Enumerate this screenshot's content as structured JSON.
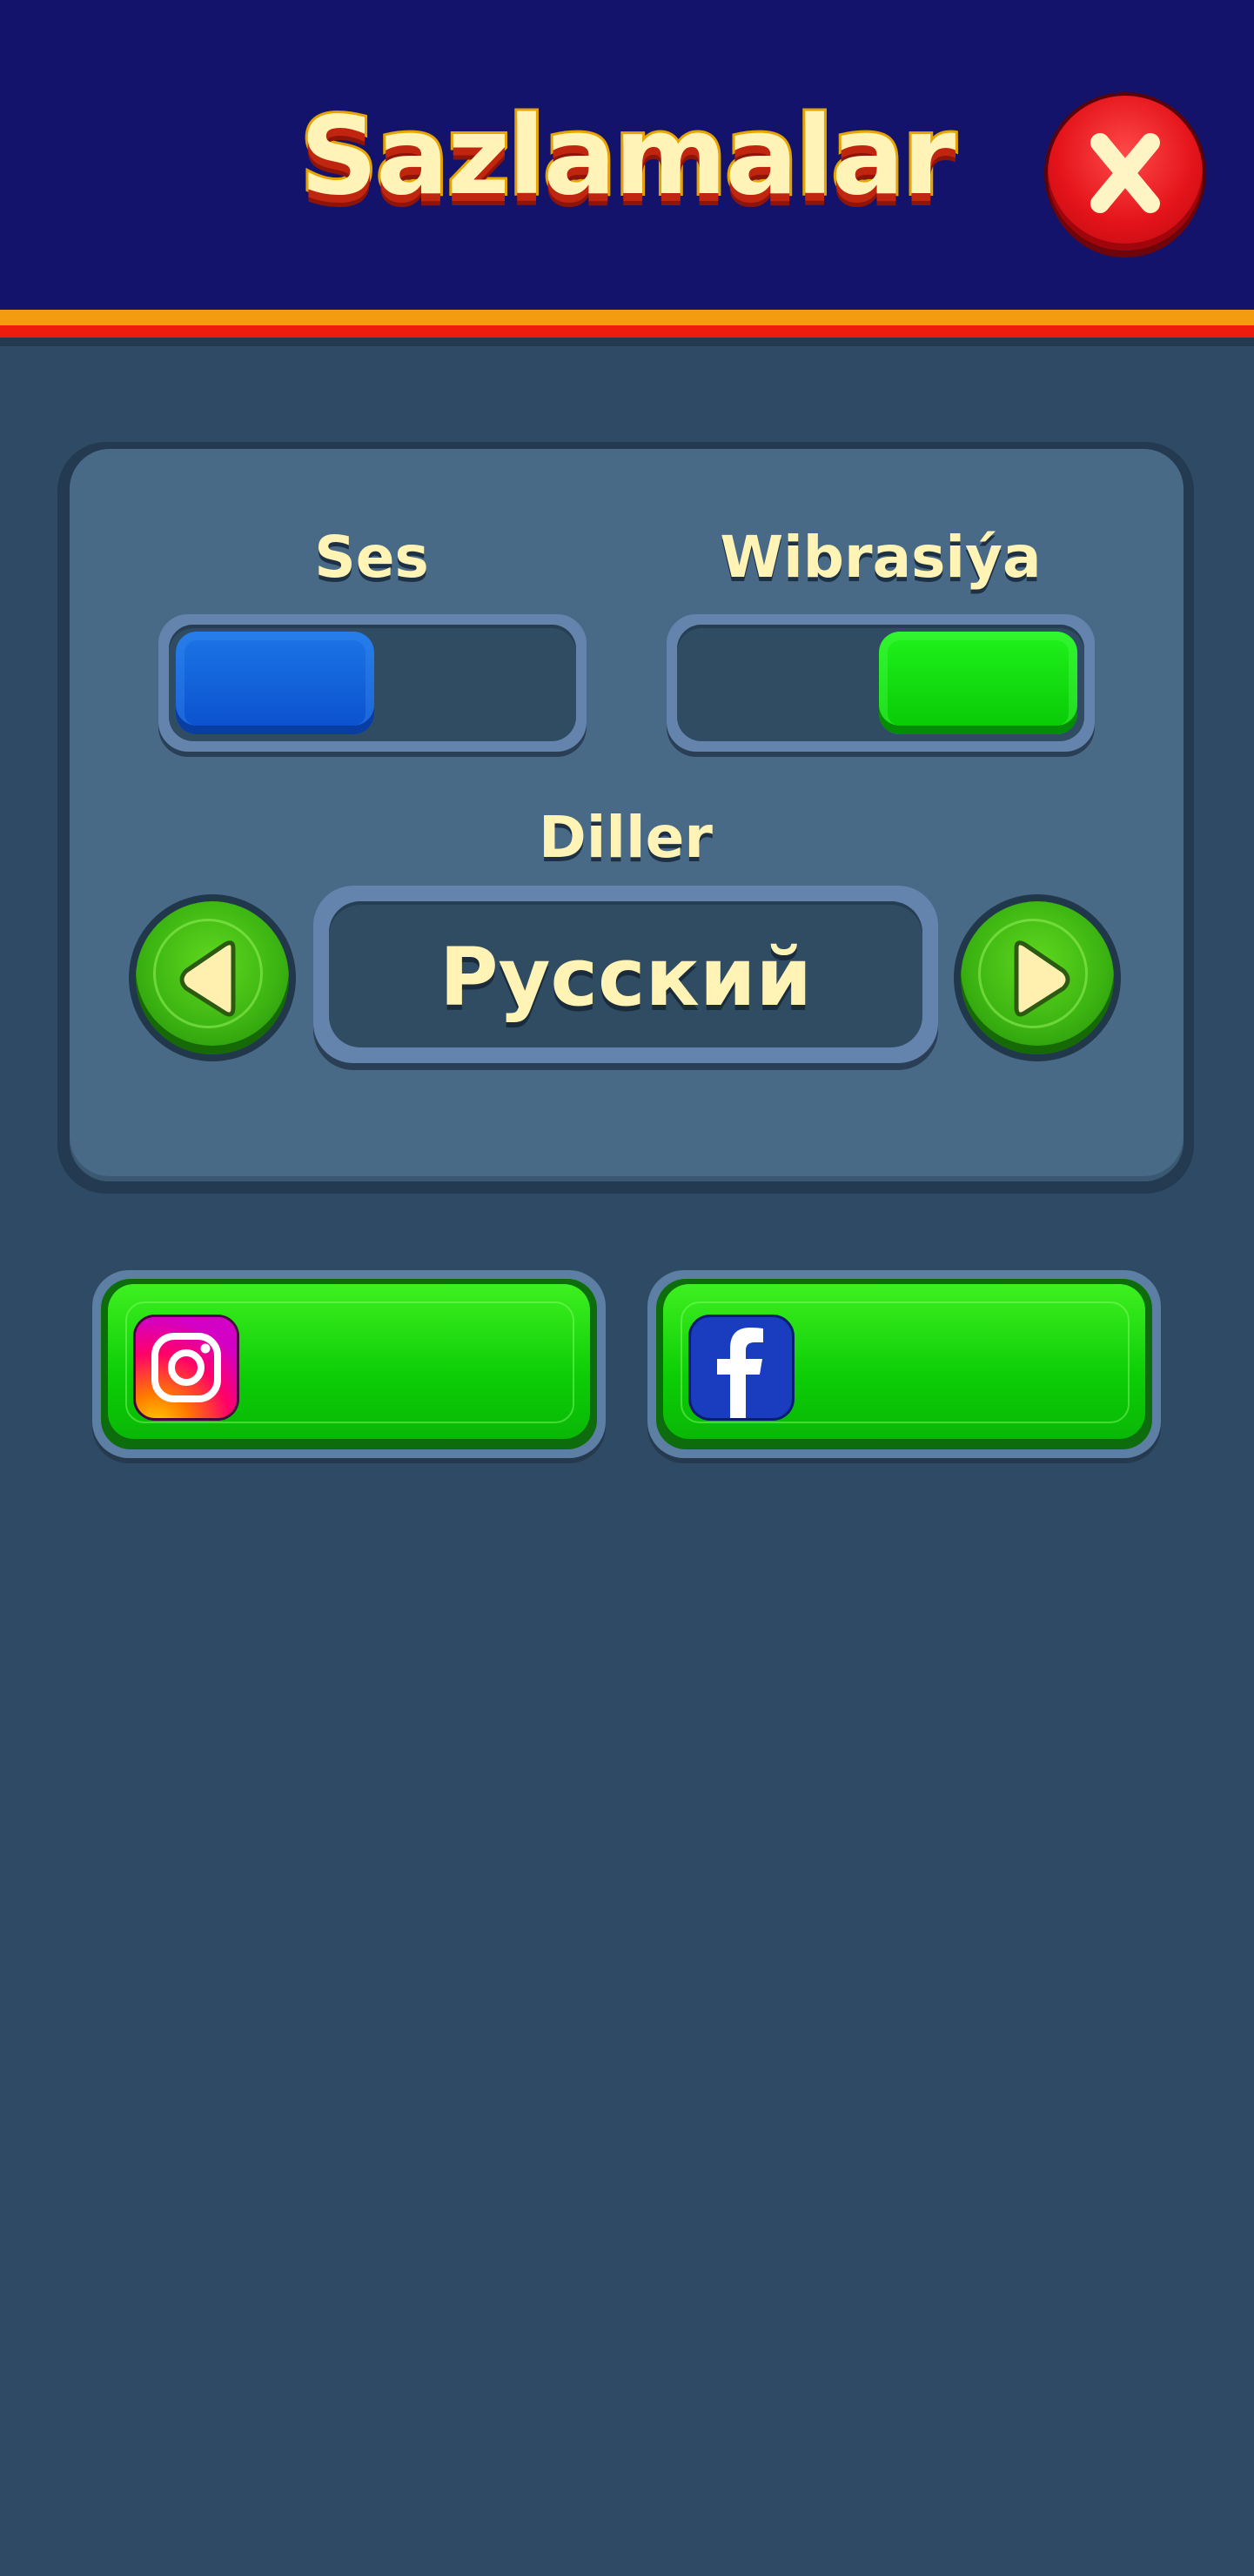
{
  "header": {
    "title": "Sazlamalar"
  },
  "settings": {
    "sound": {
      "label": "Ses",
      "enabled": false
    },
    "vibration": {
      "label": "Wibrasiýa",
      "enabled": true
    },
    "language": {
      "label": "Diller",
      "current": "Русский"
    }
  },
  "social": {
    "instagram_icon": "instagram-icon",
    "facebook_icon": "facebook-icon"
  },
  "colors": {
    "header_bg": "#14136c",
    "page_bg": "#2f4a64",
    "toggle_off": "#0a4fcd",
    "toggle_on": "#07c804",
    "close_button": "#e4141a",
    "text": "#fff4b6"
  }
}
